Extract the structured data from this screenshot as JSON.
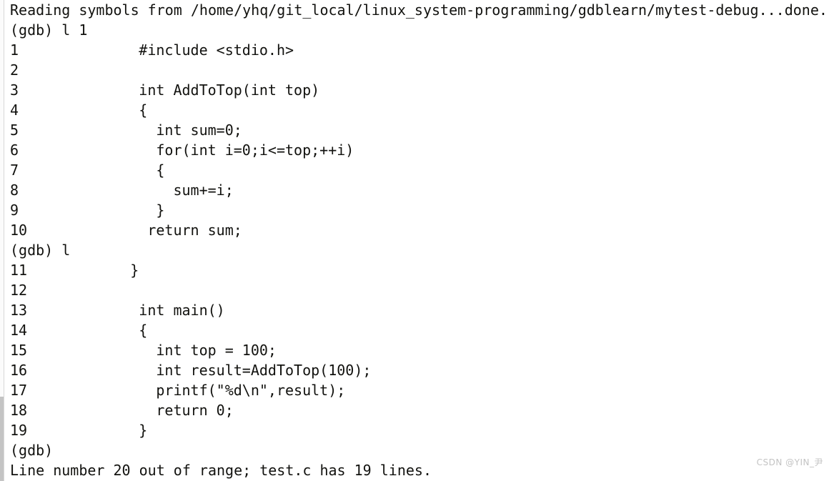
{
  "terminal": {
    "program": "gdb",
    "background_color": "#ffffff",
    "text_color": "#12120f",
    "font_size_px": 20,
    "line_height_px": 28
  },
  "scrollbar": {
    "orientation": "vertical",
    "position": "left",
    "track_color": "#fbfbfb",
    "thumb_color": "#c4c4c4"
  },
  "lines": [
    {
      "kind": "message",
      "text": "Reading symbols from /home/yhq/git_local/linux_system-programming/gdblearn/mytest-debug...done."
    },
    {
      "kind": "prompt",
      "text": "(gdb) l 1"
    },
    {
      "kind": "source",
      "number": "1",
      "code": "       #include <stdio.h>"
    },
    {
      "kind": "source",
      "number": "2",
      "code": ""
    },
    {
      "kind": "source",
      "number": "3",
      "code": "       int AddToTop(int top)"
    },
    {
      "kind": "source",
      "number": "4",
      "code": "       {"
    },
    {
      "kind": "source",
      "number": "5",
      "code": "         int sum=0;"
    },
    {
      "kind": "source",
      "number": "6",
      "code": "         for(int i=0;i<=top;++i)"
    },
    {
      "kind": "source",
      "number": "7",
      "code": "         {"
    },
    {
      "kind": "source",
      "number": "8",
      "code": "           sum+=i;"
    },
    {
      "kind": "source",
      "number": "9",
      "code": "         }"
    },
    {
      "kind": "source",
      "number": "10",
      "code": "        return sum;"
    },
    {
      "kind": "prompt",
      "text": "(gdb) l"
    },
    {
      "kind": "source",
      "number": "11",
      "code": "      }"
    },
    {
      "kind": "source",
      "number": "12",
      "code": ""
    },
    {
      "kind": "source",
      "number": "13",
      "code": "       int main()"
    },
    {
      "kind": "source",
      "number": "14",
      "code": "       {"
    },
    {
      "kind": "source",
      "number": "15",
      "code": "         int top = 100;"
    },
    {
      "kind": "source",
      "number": "16",
      "code": "         int result=AddToTop(100);"
    },
    {
      "kind": "source",
      "number": "17",
      "code": "         printf(\"%d\\n\",result);"
    },
    {
      "kind": "source",
      "number": "18",
      "code": "         return 0;"
    },
    {
      "kind": "source",
      "number": "19",
      "code": "       }"
    },
    {
      "kind": "prompt",
      "text": "(gdb)"
    },
    {
      "kind": "error",
      "text": "Line number 20 out of range; test.c has 19 lines."
    }
  ],
  "watermark": {
    "text": "CSDN @YIN_尹"
  }
}
